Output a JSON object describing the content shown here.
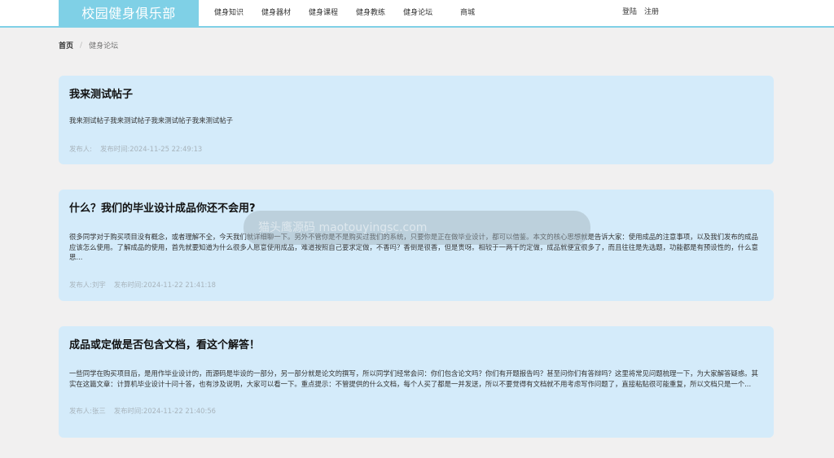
{
  "brand": {
    "title": "校园健身俱乐部"
  },
  "nav": {
    "items": [
      "健身知识",
      "健身器材",
      "健身课程",
      "健身教练",
      "健身论坛",
      "商城"
    ]
  },
  "auth": {
    "login": "登陆",
    "register": "注册"
  },
  "breadcrumb": {
    "home": "首页",
    "separator": "/",
    "current": "健身论坛"
  },
  "posts": [
    {
      "title": "我来测试帖子",
      "body": "我来测试帖子我来测试帖子我来测试帖子我来测试帖子",
      "author": "发布人:",
      "time": "发布时间:2024-11-25 22:49:13"
    },
    {
      "title": "什么？我们的毕业设计成品你还不会用?",
      "body": "很多同学对于购买项目没有概念，或者理解不全，今天我们就详细聊一下。另外不管你是不是购买过我们的系统，只要你是正在做毕业设计，都可以借鉴。本文的核心思想就是告诉大家：使用成品的注意事项，以及我们发布的成品应该怎么使用。了解成品的使用，首先就要知道为什么很多人愿意使用成品，难道按照自己要求定做，不香吗？香倒是很香，但是贵呀。相较于一两千的定做，成品就便宜很多了，而且往往是先选题，功能都是有预设性的，什么意思...",
      "author": "发布人:刘宇",
      "time": "发布时间:2024-11-22 21:41:18"
    },
    {
      "title": "成品或定做是否包含文档，看这个解答！",
      "body": "一些同学在购买项目后，是用作毕业设计的，而源码是毕设的一部分，另一部分就是论文的撰写，所以同学们经常会问：你们包含论文吗？你们有开题报告吗？甚至问你们有答辩吗？这里将常见问题梳理一下，为大家解答疑惑。其实在这篇文章：计算机毕业设计十问十答，也有涉及说明，大家可以看一下。重点提示：不管提供的什么文档，每个人买了都是一并发送，所以不要觉得有文档就不用考虑写作问题了，直接粘贴很可能重复，所以文档只是一个...",
      "author": "发布人:张三",
      "time": "发布时间:2024-11-22 21:40:56"
    }
  ],
  "watermark": {
    "text": "猫头鹰源码 maotouyingsc.com"
  },
  "colors": {
    "brand": "#7fd0e6",
    "card": "#d4ebfa",
    "page": "#f1f0f0"
  }
}
